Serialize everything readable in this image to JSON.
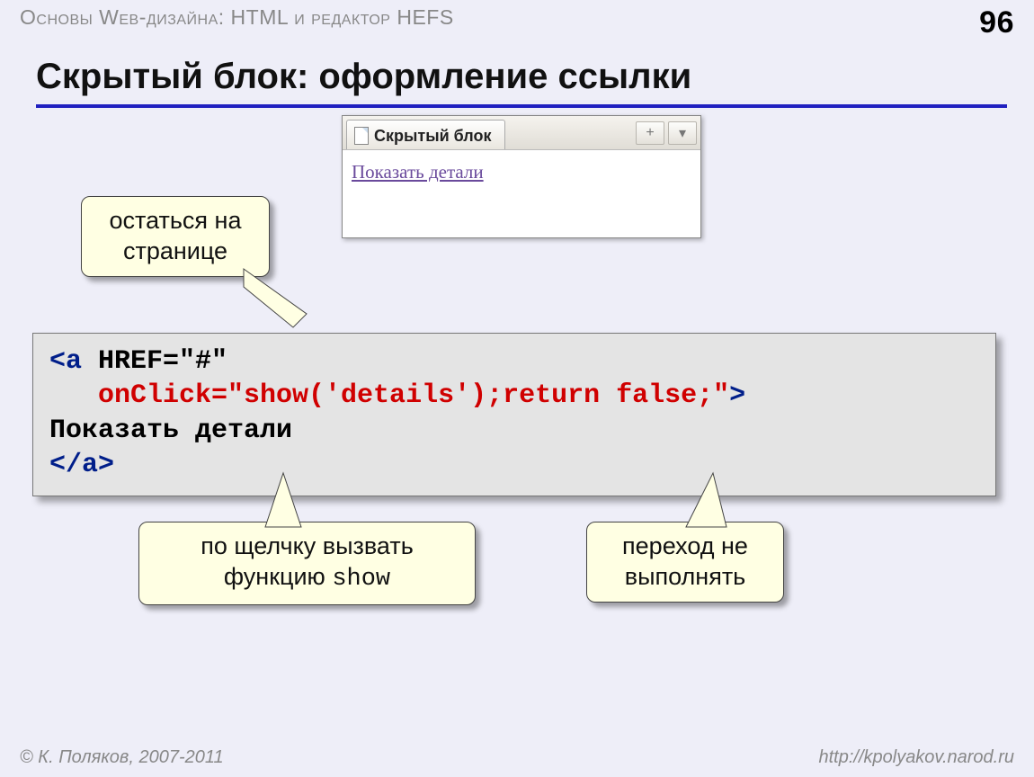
{
  "header": {
    "topic": "Основы Web-дизайна: HTML и редактор HEFS",
    "page_number": "96"
  },
  "title": "Скрытый блок: оформление ссылки",
  "browser": {
    "tab_label": "Скрытый блок",
    "link_text": "Показать детали",
    "btn_plus": "+",
    "btn_menu": "▾"
  },
  "callouts": {
    "stay": "остаться на странице",
    "click_prefix": "по щелчку вызвать функцию ",
    "click_fn": "show",
    "nogo": "переход не выполнять"
  },
  "code": {
    "l1a": "<a ",
    "l1b": "HREF=\"#\"",
    "l2": "   onClick=\"show('details');return false;\"",
    "l2end": ">",
    "l3": "Показать детали",
    "l4": "</a>"
  },
  "footer": {
    "left": "© К. Поляков, 2007-2011",
    "right": "http://kpolyakov.narod.ru"
  }
}
